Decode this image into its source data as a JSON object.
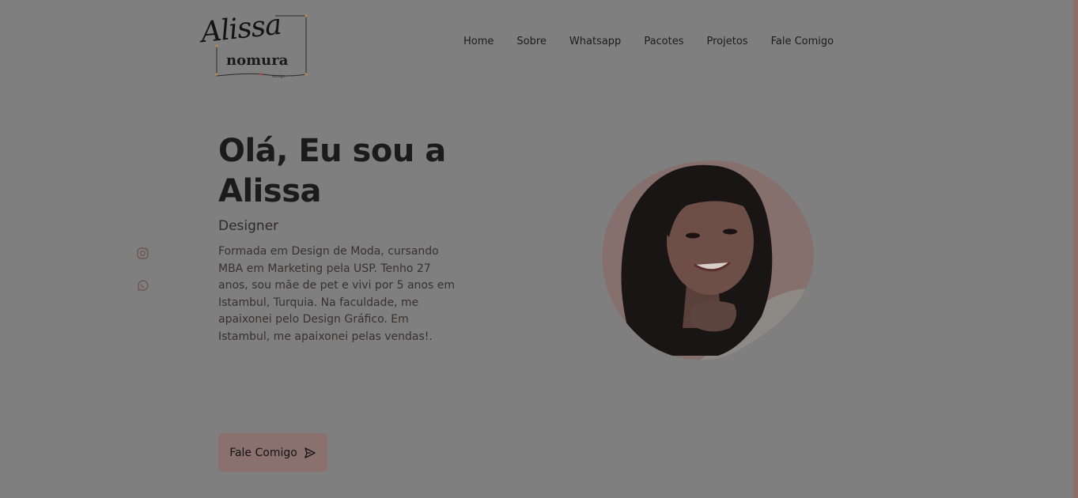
{
  "logo": {
    "script_text": "Alissa",
    "word_text": "nomura",
    "sub_text": "design"
  },
  "nav": {
    "items": [
      {
        "label": "Home"
      },
      {
        "label": "Sobre"
      },
      {
        "label": "Whatsapp"
      },
      {
        "label": "Pacotes"
      },
      {
        "label": "Projetos"
      },
      {
        "label": "Fale Comigo"
      }
    ]
  },
  "social": {
    "icons": [
      "instagram-icon",
      "whatsapp-icon"
    ]
  },
  "hero": {
    "title": "Olá, Eu sou a Alissa",
    "role": "Designer",
    "description": "Formada em Design de Moda, cursando MBA em Marketing pela USP. Tenho 27 anos, sou mãe de pet e vivi por 5 anos em Istambul, Turquia. Na faculdade, me apaixonei pelo Design Gráfico. Em Istambul, me apaixonei pelas vendas!.",
    "cta_label": "Fale Comigo",
    "cta_icon": "send-icon"
  },
  "colors": {
    "background": "#7f7f7f",
    "accent": "#8a716d",
    "photo_background": "#86706d"
  }
}
